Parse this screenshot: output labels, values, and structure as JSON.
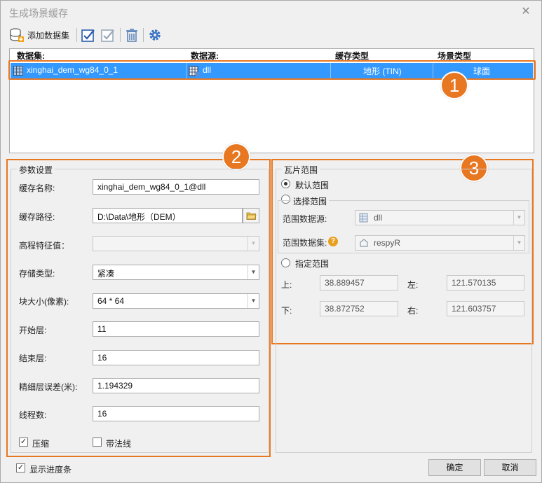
{
  "window": {
    "title": "生成场景缓存",
    "close_glyph": "✕"
  },
  "toolbar": {
    "add_dataset_label": "添加数据集"
  },
  "grid": {
    "headers": [
      "数据集:",
      "数据源:",
      "缓存类型",
      "场景类型"
    ],
    "rows": [
      {
        "dataset": "xinghai_dem_wg84_0_1",
        "datasource": "dll",
        "cache_type": "地形 (TIN)",
        "scene_type": "球面"
      }
    ]
  },
  "callouts": [
    "1",
    "2",
    "3"
  ],
  "params": {
    "legend": "参数设置",
    "cache_name_label": "缓存名称:",
    "cache_name_value": "xinghai_dem_wg84_0_1@dll",
    "cache_path_label": "缓存路径:",
    "cache_path_value": "D:\\Data\\地形（DEM）",
    "elevation_label": "高程特征值：",
    "elevation_value": "",
    "storage_label": "存储类型:",
    "storage_value": "紧凑",
    "block_label": "块大小(像素):",
    "block_value": "64 * 64",
    "start_label": "开始层:",
    "start_value": "11",
    "end_label": "结束层:",
    "end_value": "16",
    "error_label": "精细层误差(米):",
    "error_value": "1.194329",
    "threads_label": "线程数:",
    "threads_value": "16",
    "compress_label": "压缩",
    "compress_checked": true,
    "normal_label": "带法线",
    "normal_checked": false
  },
  "tile_range": {
    "legend": "瓦片范围",
    "default_label": "默认范围",
    "select_label": "选择范围",
    "source_label": "范围数据源:",
    "source_value": "dll",
    "dataset_label": "范围数据集:",
    "dataset_value": "respyR",
    "custom_label": "指定范围",
    "top_label": "上:",
    "top_value": "38.889457",
    "left_label": "左:",
    "left_value": "121.570135",
    "bottom_label": "下:",
    "bottom_value": "38.872752",
    "right_label": "右:",
    "right_value": "121.603757",
    "selected": "default"
  },
  "footer": {
    "show_progress_label": "显示进度条",
    "show_progress_checked": true,
    "ok_label": "确定",
    "cancel_label": "取消"
  },
  "colors": {
    "accent_orange": "#e87722",
    "selection_blue": "#3399ff"
  }
}
